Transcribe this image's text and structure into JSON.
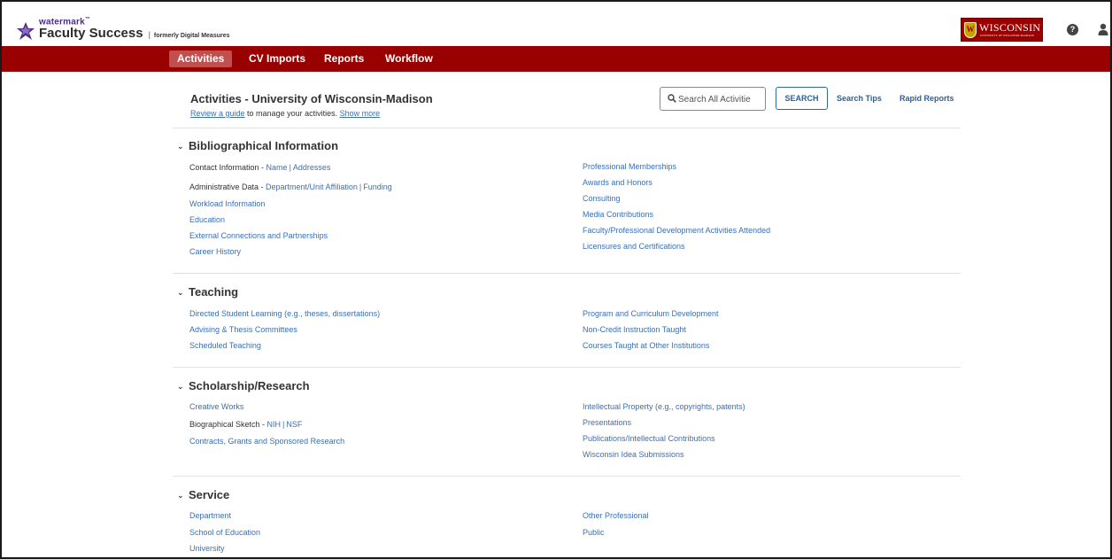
{
  "header": {
    "brand_small": "watermark",
    "brand_tm": "™",
    "brand_main": "Faculty Success",
    "brand_separator": "|",
    "brand_formerly": "formerly Digital Measures",
    "institution_logo": "WISCONSIN",
    "institution_sub": "UNIVERSITY OF WISCONSIN-MADISON",
    "help_icon": "?"
  },
  "nav": {
    "tabs": [
      {
        "label": "Activities",
        "active": true
      },
      {
        "label": "CV Imports",
        "active": false
      },
      {
        "label": "Reports",
        "active": false
      },
      {
        "label": "Workflow",
        "active": false
      }
    ]
  },
  "page": {
    "title": "Activities - University of Wisconsin-Madison",
    "guide_link": "Review a guide",
    "guide_text": " to manage your activities. ",
    "show_more": "Show more",
    "search_placeholder": "Search All Activitie",
    "search_button": "SEARCH",
    "search_tips": "Search Tips",
    "rapid_reports": "Rapid Reports"
  },
  "sections": [
    {
      "title": "Bibliographical Information",
      "left": [
        {
          "prefix": "Contact Information - ",
          "links": [
            "Name",
            "Addresses"
          ]
        },
        {
          "prefix": "Administrative Data - ",
          "links": [
            "Department/Unit Affiliation",
            "Funding"
          ]
        },
        {
          "label": "Workload Information"
        },
        {
          "label": "Education"
        },
        {
          "label": "External Connections and Partnerships"
        },
        {
          "label": "Career History"
        }
      ],
      "right": [
        {
          "label": "Professional Memberships"
        },
        {
          "label": "Awards and Honors"
        },
        {
          "label": "Consulting"
        },
        {
          "label": "Media Contributions"
        },
        {
          "label": "Faculty/Professional Development Activities Attended"
        },
        {
          "label": "Licensures and Certifications"
        }
      ]
    },
    {
      "title": "Teaching",
      "left": [
        {
          "label": "Directed Student Learning (e.g., theses, dissertations)"
        },
        {
          "label": "Advising & Thesis Committees"
        },
        {
          "label": "Scheduled Teaching"
        }
      ],
      "right": [
        {
          "label": "Program and Curriculum Development"
        },
        {
          "label": "Non-Credit Instruction Taught"
        },
        {
          "label": "Courses Taught at Other Institutions"
        }
      ]
    },
    {
      "title": "Scholarship/Research",
      "left": [
        {
          "label": "Creative Works"
        },
        {
          "prefix": "Biographical Sketch - ",
          "links": [
            "NIH",
            "NSF"
          ]
        },
        {
          "label": "Contracts, Grants and Sponsored Research"
        }
      ],
      "right": [
        {
          "label": "Intellectual Property (e.g., copyrights, patents)"
        },
        {
          "label": "Presentations"
        },
        {
          "label": "Publications/Intellectual Contributions"
        },
        {
          "label": "Wisconsin Idea Submissions"
        }
      ]
    },
    {
      "title": "Service",
      "left": [
        {
          "label": "Department"
        },
        {
          "label": "School of Education"
        },
        {
          "label": "University"
        }
      ],
      "right": [
        {
          "label": "Other Professional"
        },
        {
          "label": "Public"
        }
      ]
    }
  ],
  "colors": {
    "nav_background": "#990000",
    "nav_active": "#c05050",
    "link": "#3a6fb5",
    "button_border": "#2d6aa6"
  }
}
